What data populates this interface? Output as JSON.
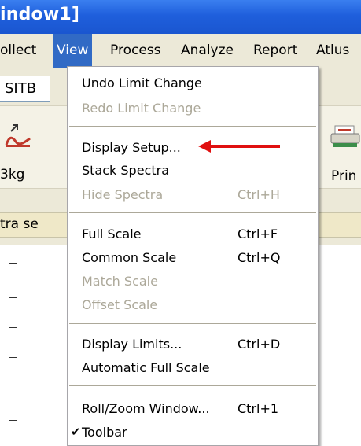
{
  "window": {
    "title": "indow1]"
  },
  "menubar": {
    "items": [
      {
        "label": "ollect"
      },
      {
        "label": "View",
        "active": true
      },
      {
        "label": "Process"
      },
      {
        "label": "Analyze"
      },
      {
        "label": "Report"
      },
      {
        "label": "Atlus"
      }
    ]
  },
  "app": {
    "field_text": "SITB",
    "toolbar_left_label": "3kg",
    "toolbar_right_label": "Prin",
    "status_text": "tra se"
  },
  "view_menu": {
    "items": [
      {
        "label": "Undo Limit Change",
        "shortcut": "",
        "enabled": true
      },
      {
        "label": "Redo Limit Change",
        "shortcut": "",
        "enabled": false
      },
      {
        "label": "Display Setup...",
        "shortcut": "",
        "enabled": true
      },
      {
        "label": "Stack Spectra",
        "shortcut": "",
        "enabled": true
      },
      {
        "label": "Hide Spectra",
        "shortcut": "Ctrl+H",
        "enabled": false
      },
      {
        "label": "Full Scale",
        "shortcut": "Ctrl+F",
        "enabled": true
      },
      {
        "label": "Common Scale",
        "shortcut": "Ctrl+Q",
        "enabled": true
      },
      {
        "label": "Match Scale",
        "shortcut": "",
        "enabled": false
      },
      {
        "label": "Offset Scale",
        "shortcut": "",
        "enabled": false
      },
      {
        "label": "Display Limits...",
        "shortcut": "Ctrl+D",
        "enabled": true
      },
      {
        "label": "Automatic Full Scale",
        "shortcut": "",
        "enabled": true
      },
      {
        "label": "Roll/Zoom Window...",
        "shortcut": "Ctrl+1",
        "enabled": true
      },
      {
        "label": "Toolbar",
        "shortcut": "",
        "enabled": true,
        "checked": true
      }
    ]
  },
  "colors": {
    "titlebar": "#1f5fdc",
    "menu_highlight": "#316ac5",
    "menu_bg": "#ece9d8",
    "disabled_text": "#aca899",
    "annotation_arrow": "#e01010"
  },
  "icons": {
    "checkmark": "check-icon",
    "left_tool": "background-subtract-icon",
    "right_tool": "printer-icon"
  }
}
